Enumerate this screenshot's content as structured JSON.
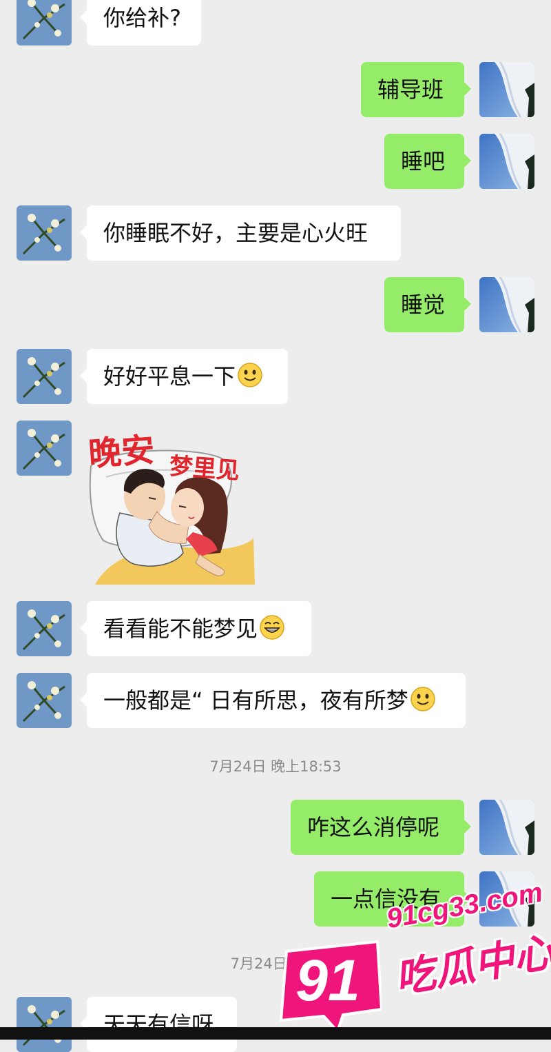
{
  "messages": {
    "m1": {
      "text": "你给补?"
    },
    "m2": {
      "text": "辅导班"
    },
    "m3": {
      "text": "睡吧"
    },
    "m4": {
      "text": "你睡眠不好，主要是心火旺"
    },
    "m5": {
      "text": "睡觉"
    },
    "m6": {
      "text": "好好平息一下",
      "emoji": "smile-emoji"
    },
    "m7": {
      "sticker": {
        "line1": "晚安",
        "line2": "梦里见"
      }
    },
    "m8": {
      "text": "看看能不能梦见",
      "emoji": "grin-emoji"
    },
    "m9": {
      "text": "一般都是“ 日有所思，夜有所梦",
      "emoji": "smile-emoji"
    },
    "m10": {
      "text": "咋这么消停呢"
    },
    "m11": {
      "text": "一点信没有"
    },
    "m12": {
      "text": "天天有信呀"
    }
  },
  "timestamps": {
    "t1": "7月24日 晚上18:53",
    "t2": "7月24日 晚上"
  },
  "watermark": {
    "number": "91",
    "url": "91cg33.com",
    "brand": "吃瓜中心"
  },
  "colors": {
    "background": "#ededed",
    "incoming_bubble": "#ffffff",
    "outgoing_bubble": "#95ec69",
    "watermark": "#f0157a"
  }
}
